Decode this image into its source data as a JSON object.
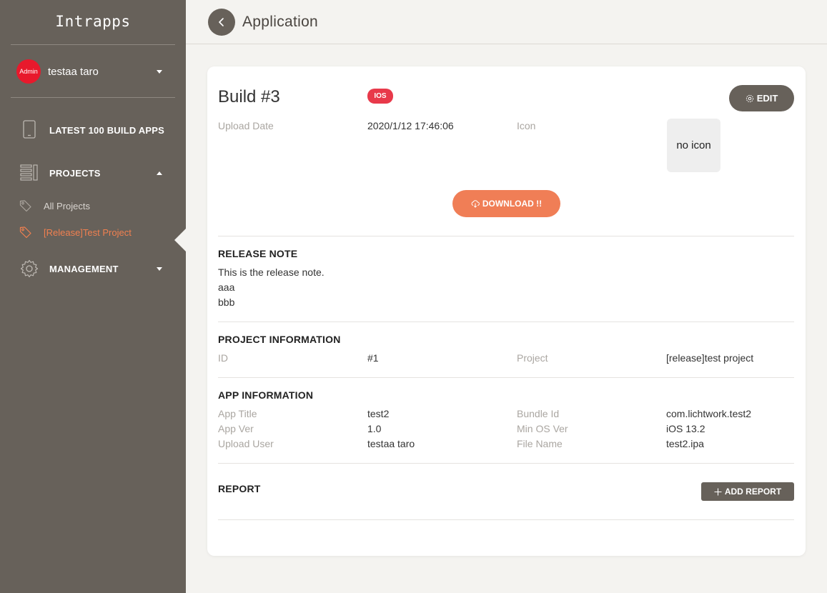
{
  "app": {
    "brand": "Intrapps"
  },
  "user": {
    "badge": "Admin",
    "name": "testaa taro"
  },
  "nav": {
    "latest": "LATEST 100 BUILD APPS",
    "projects": "PROJECTS",
    "all_projects": "All Projects",
    "current_project": "[Release]Test Project",
    "management": "MANAGEMENT"
  },
  "header": {
    "title": "Application"
  },
  "build": {
    "title": "Build #3",
    "platform": "IOS",
    "edit_label": "EDIT",
    "upload_date_label": "Upload Date",
    "upload_date": "2020/1/12 17:46:06",
    "icon_label": "Icon",
    "icon_placeholder": "no icon",
    "download_label": "DOWNLOAD !!"
  },
  "release_note": {
    "title": "RELEASE NOTE",
    "lines": [
      "This is the release note.",
      "aaa",
      "bbb"
    ]
  },
  "project_info": {
    "title": "PROJECT INFORMATION",
    "id_label": "ID",
    "id": "#1",
    "project_label": "Project",
    "project": "[release]test project"
  },
  "app_info": {
    "title": "APP INFORMATION",
    "app_title_label": "App Title",
    "app_title": "test2",
    "app_ver_label": "App Ver",
    "app_ver": "1.0",
    "upload_user_label": "Upload User",
    "upload_user": "testaa taro",
    "bundle_id_label": "Bundle Id",
    "bundle_id": "com.lichtwork.test2",
    "min_os_label": "Min OS Ver",
    "min_os": "iOS 13.2",
    "file_name_label": "File Name",
    "file_name": "test2.ipa"
  },
  "report": {
    "title": "REPORT",
    "add_label": "ADD REPORT"
  },
  "colors": {
    "sidebar": "#67615a",
    "accent": "#f07e56",
    "badge": "#e8394a",
    "avatar": "#e8192c"
  }
}
